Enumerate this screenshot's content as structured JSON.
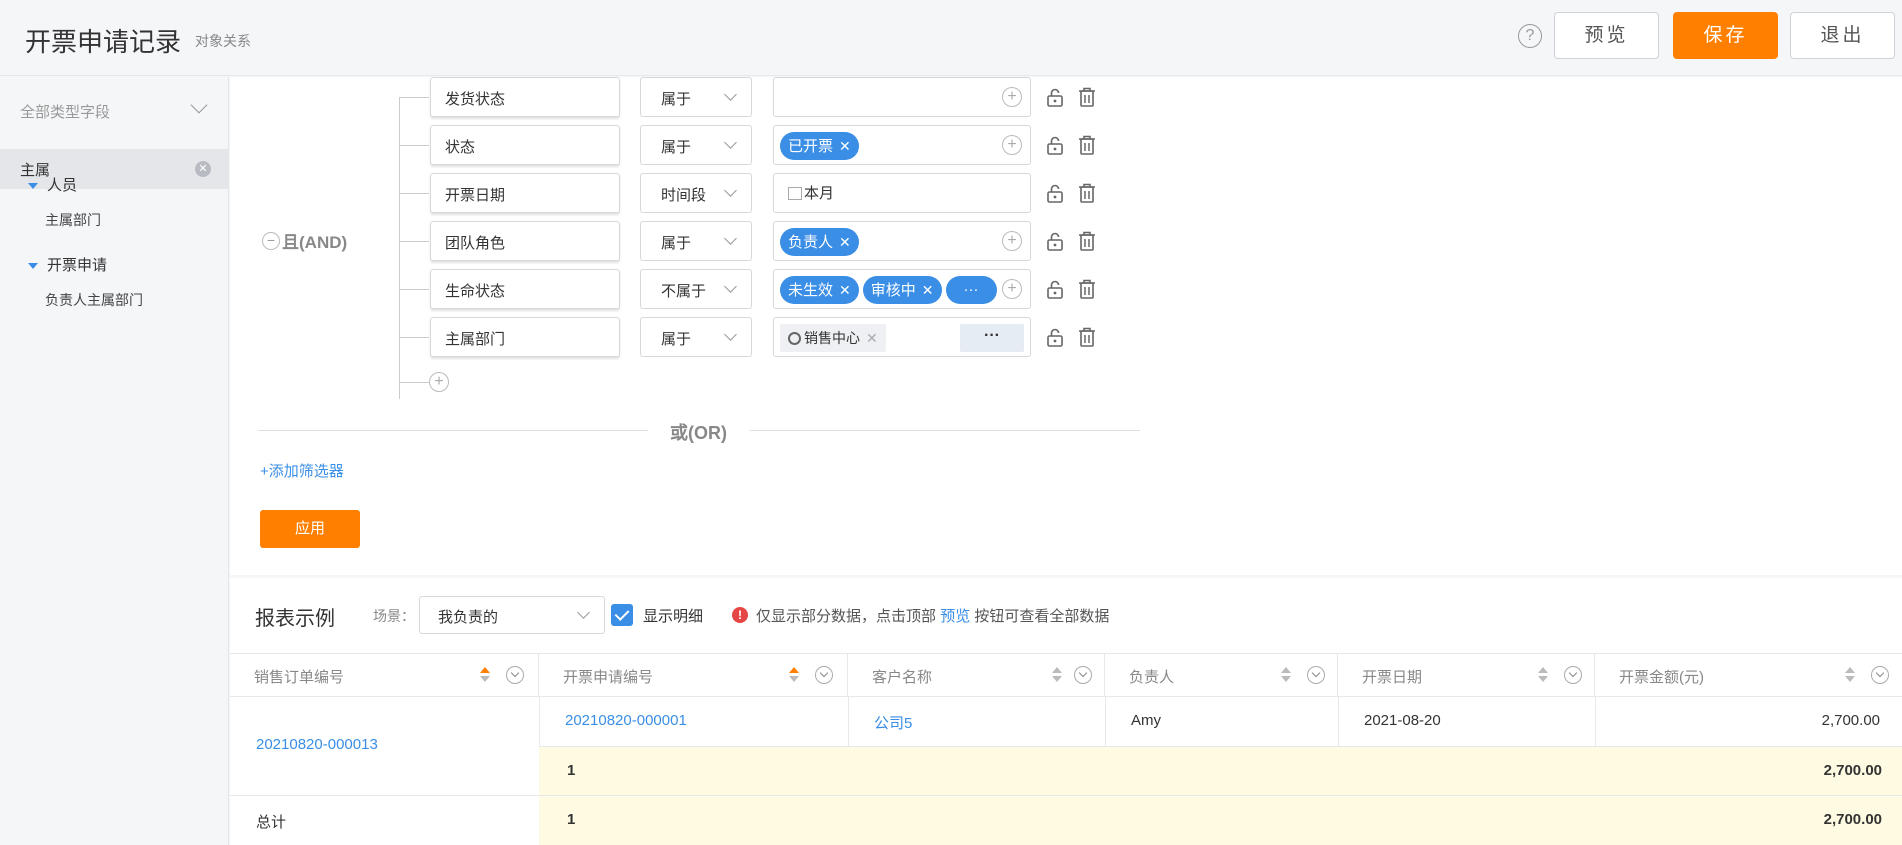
{
  "header": {
    "title": "开票申请记录",
    "subtitle": "对象关系",
    "help_icon": "?",
    "preview_label": "预览",
    "save_label": "保存",
    "exit_label": "退出"
  },
  "sidebar": {
    "select_label": "全部类型字段",
    "active_item": "主属",
    "groups": [
      {
        "label": "人员",
        "items": [
          "主属部门"
        ]
      },
      {
        "label": "开票申请",
        "items": [
          "负责人主属部门"
        ]
      }
    ]
  },
  "filter": {
    "logic_label": "且(AND)",
    "rows": [
      {
        "field": "发货状态",
        "operator": "属于"
      },
      {
        "field": "状态",
        "operator": "属于",
        "tags": [
          "已开票"
        ]
      },
      {
        "field": "开票日期",
        "operator": "时间段",
        "value_text": "本月"
      },
      {
        "field": "团队角色",
        "operator": "属于",
        "tags": [
          "负责人"
        ]
      },
      {
        "field": "生命状态",
        "operator": "不属于",
        "tags": [
          "未生效",
          "审核中"
        ],
        "more": "···"
      },
      {
        "field": "主属部门",
        "operator": "属于",
        "dept_chip": "销售中心",
        "more": "···"
      }
    ],
    "or_label": "或(OR)",
    "add_filter_label": "+添加筛选器",
    "apply_label": "应用"
  },
  "report": {
    "title": "报表示例",
    "scene_label": "场景：",
    "scene_value": "我负责的",
    "show_detail_label": "显示明细",
    "notice_prefix": "仅显示部分数据，点击顶部",
    "notice_link": "预览",
    "notice_suffix": "按钮可查看全部数据",
    "columns": [
      "销售订单编号",
      "开票申请编号",
      "客户名称",
      "负责人",
      "开票日期",
      "开票金额(元)"
    ],
    "row": {
      "order_no": "20210820-000013",
      "apply_no": "20210820-000001",
      "customer": "公司5",
      "owner": "Amy",
      "date": "2021-08-20",
      "amount": "2,700.00"
    },
    "subtotal": {
      "count": "1",
      "amount": "2,700.00"
    },
    "total": {
      "label": "总计",
      "count": "1",
      "amount": "2,700.00"
    }
  },
  "colors": {
    "accent": "#ff7f00",
    "link": "#3a8ee6",
    "subtotal_bg": "#fffbe3"
  }
}
